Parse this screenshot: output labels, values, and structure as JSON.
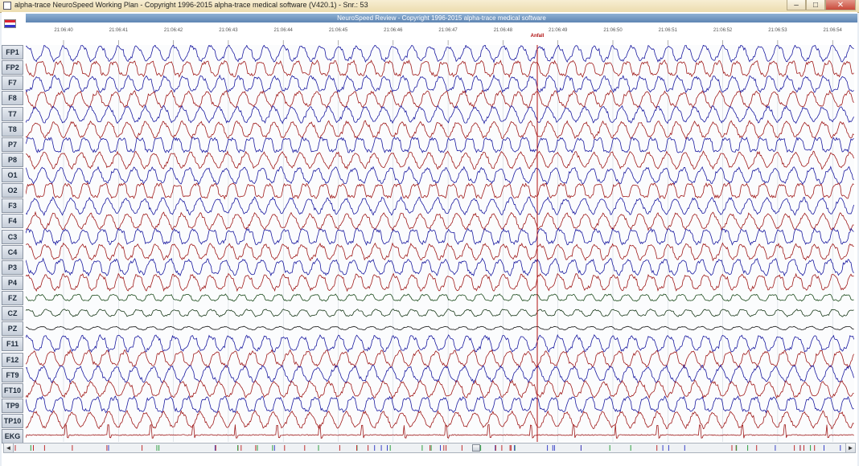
{
  "window": {
    "title": "alpha-trace NeuroSpeed Working Plan - Copyright 1996-2015 alpha-trace medical software (V420.1) - Snr.: 53",
    "buttons": {
      "minimize": "–",
      "maximize": "□",
      "close": "✕"
    }
  },
  "review": {
    "title": "NeuroSpeed Review - Copyright 1996-2015 alpha-trace medical software",
    "marker": "Anfall",
    "times": [
      "21:06:40",
      "21:06:41",
      "21:06:42",
      "21:06:43",
      "21:06:44",
      "21:06:45",
      "21:06:46",
      "21:06:47",
      "21:06:48",
      "21:06:49",
      "21:06:50",
      "21:06:51",
      "21:06:52",
      "21:06:53",
      "21:06:54"
    ]
  },
  "channels": [
    {
      "name": "FP1",
      "color": "#1a1aa0"
    },
    {
      "name": "FP2",
      "color": "#a01a1a"
    },
    {
      "name": "F7",
      "color": "#1a1aa0"
    },
    {
      "name": "F8",
      "color": "#a01a1a"
    },
    {
      "name": "T7",
      "color": "#1a1aa0"
    },
    {
      "name": "T8",
      "color": "#a01a1a"
    },
    {
      "name": "P7",
      "color": "#1a1aa0"
    },
    {
      "name": "P8",
      "color": "#a01a1a"
    },
    {
      "name": "O1",
      "color": "#1a1aa0"
    },
    {
      "name": "O2",
      "color": "#a01a1a"
    },
    {
      "name": "F3",
      "color": "#1a1aa0"
    },
    {
      "name": "F4",
      "color": "#a01a1a"
    },
    {
      "name": "C3",
      "color": "#1a1aa0"
    },
    {
      "name": "C4",
      "color": "#a01a1a"
    },
    {
      "name": "P3",
      "color": "#1a1aa0"
    },
    {
      "name": "P4",
      "color": "#a01a1a"
    },
    {
      "name": "FZ",
      "color": "#1a4a1a"
    },
    {
      "name": "CZ",
      "color": "#1a3a1a"
    },
    {
      "name": "PZ",
      "color": "#111111"
    },
    {
      "name": "F11",
      "color": "#1a1aa0"
    },
    {
      "name": "F12",
      "color": "#a01a1a"
    },
    {
      "name": "FT9",
      "color": "#1a1aa0"
    },
    {
      "name": "FT10",
      "color": "#a01a1a"
    },
    {
      "name": "TP9",
      "color": "#1a1aa0"
    },
    {
      "name": "TP10",
      "color": "#a01a1a"
    },
    {
      "name": "EKG",
      "color": "#a01a1a"
    }
  ],
  "colors": {
    "grid": "#c8d0d8",
    "marker": "#b01010"
  }
}
